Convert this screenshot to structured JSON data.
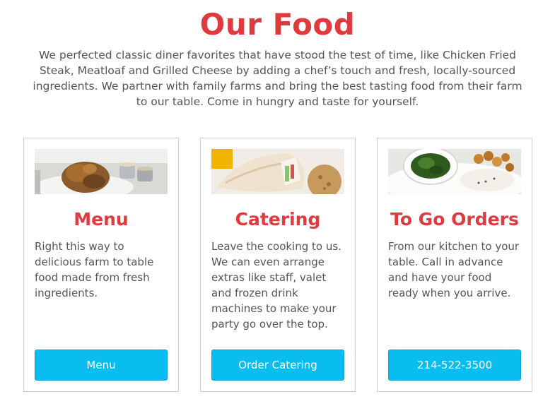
{
  "heading": "Our Food",
  "intro": "We perfected classic diner favorites that have stood the test of time, like Chicken Fried Steak, Meatloaf and Grilled Cheese by adding a chef’s touch and fresh, locally-sourced ingredients. We partner with family farms and bring the best tasting food from their farm to our table. Come in hungry and taste for yourself.",
  "cards": [
    {
      "image": "fried-chicken-photo",
      "title": "Menu",
      "text": "Right this way to delicious farm to table food made from fresh ingredients.",
      "button": "Menu"
    },
    {
      "image": "wrap-sandwich-photo",
      "title": "Catering",
      "text": "Leave the cooking to us. We can even arrange extras like staff, valet and frozen drink machines to make your party go over the top.",
      "button": "Order Catering"
    },
    {
      "image": "plated-meal-photo",
      "title": "To Go Orders",
      "text": "From our kitchen to your table. Call in advance and have your food ready when you arrive.",
      "button": "214-522-3500"
    }
  ],
  "colors": {
    "heading": "#e03a3e",
    "button": "#0abdf0",
    "button_text": "#ffffff"
  }
}
